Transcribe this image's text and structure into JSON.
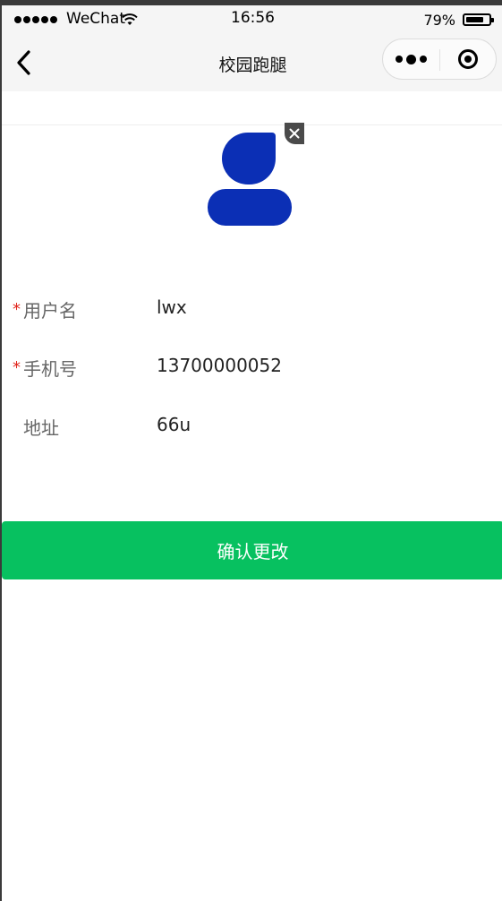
{
  "status_bar": {
    "carrier": "WeChat",
    "time": "16:56",
    "battery_percent": "79%",
    "battery_level": 0.79
  },
  "nav": {
    "title": "校园跑腿",
    "back_icon": "chevron-left-icon",
    "menu_icon": "more-dots-icon",
    "close_icon": "target-circle-icon"
  },
  "avatar": {
    "icon": "user-avatar-icon",
    "color": "#0b2fb5",
    "remove_icon": "close-icon"
  },
  "form": {
    "fields": [
      {
        "label": "用户名",
        "required": true,
        "value": "lwx"
      },
      {
        "label": "手机号",
        "required": true,
        "value": "13700000052"
      },
      {
        "label": "地址",
        "required": false,
        "value": "66u"
      }
    ],
    "required_mark": "*"
  },
  "confirm_button": {
    "label": "确认更改",
    "color": "#07c160"
  }
}
